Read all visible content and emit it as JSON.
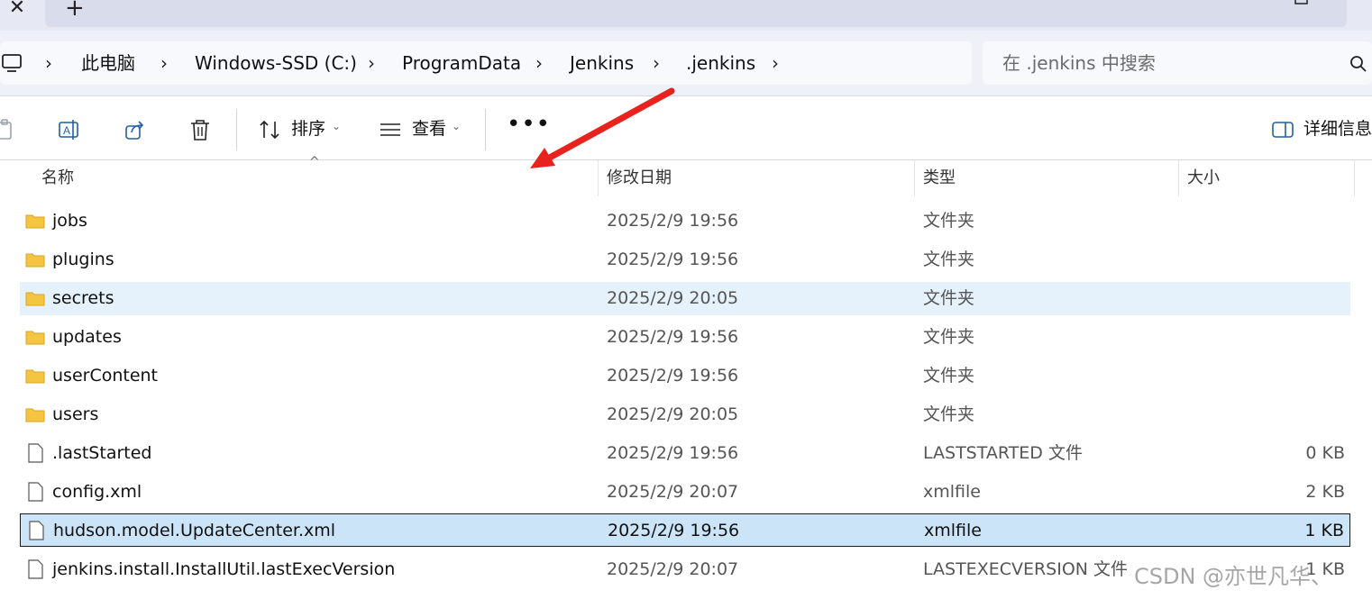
{
  "window": {
    "tab_close": "✕",
    "new_tab": "+"
  },
  "address": {
    "icon": "pc-icon",
    "crumbs": [
      "此电脑",
      "Windows-SSD (C:)",
      "ProgramData",
      "Jenkins",
      ".jenkins"
    ],
    "separator": "›"
  },
  "search": {
    "placeholder": "在 .jenkins 中搜索",
    "icon": "search-icon"
  },
  "toolbar": {
    "sort_label": "排序",
    "view_label": "查看",
    "more_label": "•••",
    "details_label": "详细信息",
    "caret": "⌄"
  },
  "columns": {
    "name": "名称",
    "date": "修改日期",
    "type": "类型",
    "size": "大小",
    "sort_indicator": "^"
  },
  "files": [
    {
      "name": "jobs",
      "date": "2025/2/9 19:56",
      "type": "文件夹",
      "size": "",
      "kind": "folder"
    },
    {
      "name": "plugins",
      "date": "2025/2/9 19:56",
      "type": "文件夹",
      "size": "",
      "kind": "folder"
    },
    {
      "name": "secrets",
      "date": "2025/2/9 20:05",
      "type": "文件夹",
      "size": "",
      "kind": "folder"
    },
    {
      "name": "updates",
      "date": "2025/2/9 19:56",
      "type": "文件夹",
      "size": "",
      "kind": "folder"
    },
    {
      "name": "userContent",
      "date": "2025/2/9 19:56",
      "type": "文件夹",
      "size": "",
      "kind": "folder"
    },
    {
      "name": "users",
      "date": "2025/2/9 20:05",
      "type": "文件夹",
      "size": "",
      "kind": "folder"
    },
    {
      "name": ".lastStarted",
      "date": "2025/2/9 19:56",
      "type": "LASTSTARTED 文件",
      "size": "0 KB",
      "kind": "file"
    },
    {
      "name": "config.xml",
      "date": "2025/2/9 20:07",
      "type": "xmlfile",
      "size": "2 KB",
      "kind": "file"
    },
    {
      "name": "hudson.model.UpdateCenter.xml",
      "date": "2025/2/9 19:56",
      "type": "xmlfile",
      "size": "1 KB",
      "kind": "file"
    },
    {
      "name": "jenkins.install.InstallUtil.lastExecVersion",
      "date": "2025/2/9 20:07",
      "type": "LASTEXECVERSION 文件",
      "size": "1 KB",
      "kind": "file"
    }
  ],
  "watermark": "CSDN @亦世凡华、",
  "colors": {
    "hover_row": "#e5f1fb",
    "selected_row": "#cce4f7",
    "folder": "#f5c542",
    "annotation_arrow": "#e8231d"
  }
}
